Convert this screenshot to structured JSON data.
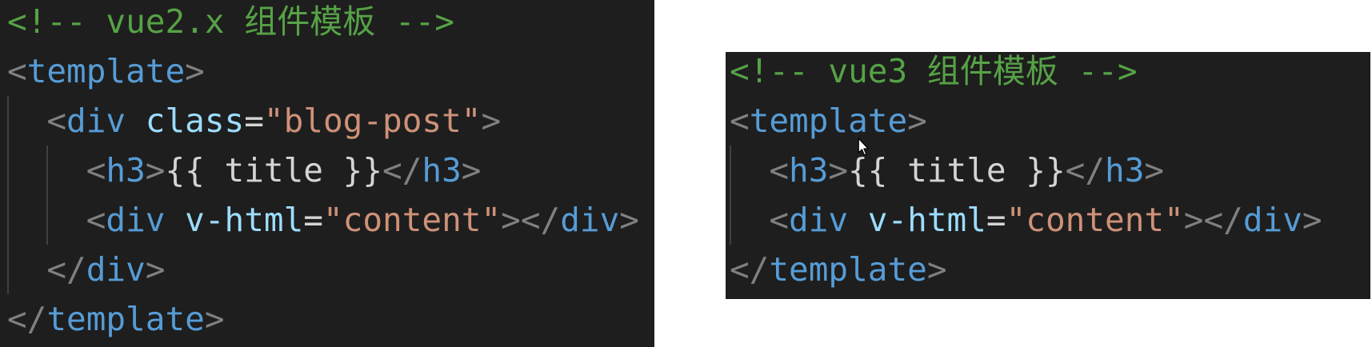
{
  "colors": {
    "page_background": "#ffffff",
    "editor_background": "#1e1e1e",
    "comment": "#56a246",
    "bracket": "#808080",
    "tag": "#569cd6",
    "attribute": "#9cdcfe",
    "plain": "#d4d4d4",
    "string": "#ce9178",
    "indent_guide": "#404040"
  },
  "icons": {
    "cursor": "arrow-cursor-icon"
  },
  "left": {
    "lines": [
      [
        "<!-- vue2.x 组件模板 -->"
      ],
      [
        "<",
        "template",
        ">"
      ],
      [
        "<",
        "div",
        "class",
        "=",
        "\"blog-post\"",
        ">"
      ],
      [
        "<",
        "h3",
        ">",
        "{{ title }}",
        "</",
        "h3",
        ">"
      ],
      [
        "<",
        "div",
        "v-html",
        "=",
        "\"content\"",
        "></",
        "div",
        ">"
      ],
      [
        "</",
        "div",
        ">"
      ],
      [
        "</",
        "template",
        ">"
      ]
    ]
  },
  "right": {
    "lines": [
      [
        "<!-- vue3 组件模板 -->"
      ],
      [
        "<",
        "template",
        ">"
      ],
      [
        "<",
        "h3",
        ">",
        "{{ title }}",
        "</",
        "h3",
        ">"
      ],
      [
        "<",
        "div",
        "v-html",
        "=",
        "\"content\"",
        "></",
        "div",
        ">"
      ],
      [
        "</",
        "template",
        ">"
      ]
    ]
  }
}
